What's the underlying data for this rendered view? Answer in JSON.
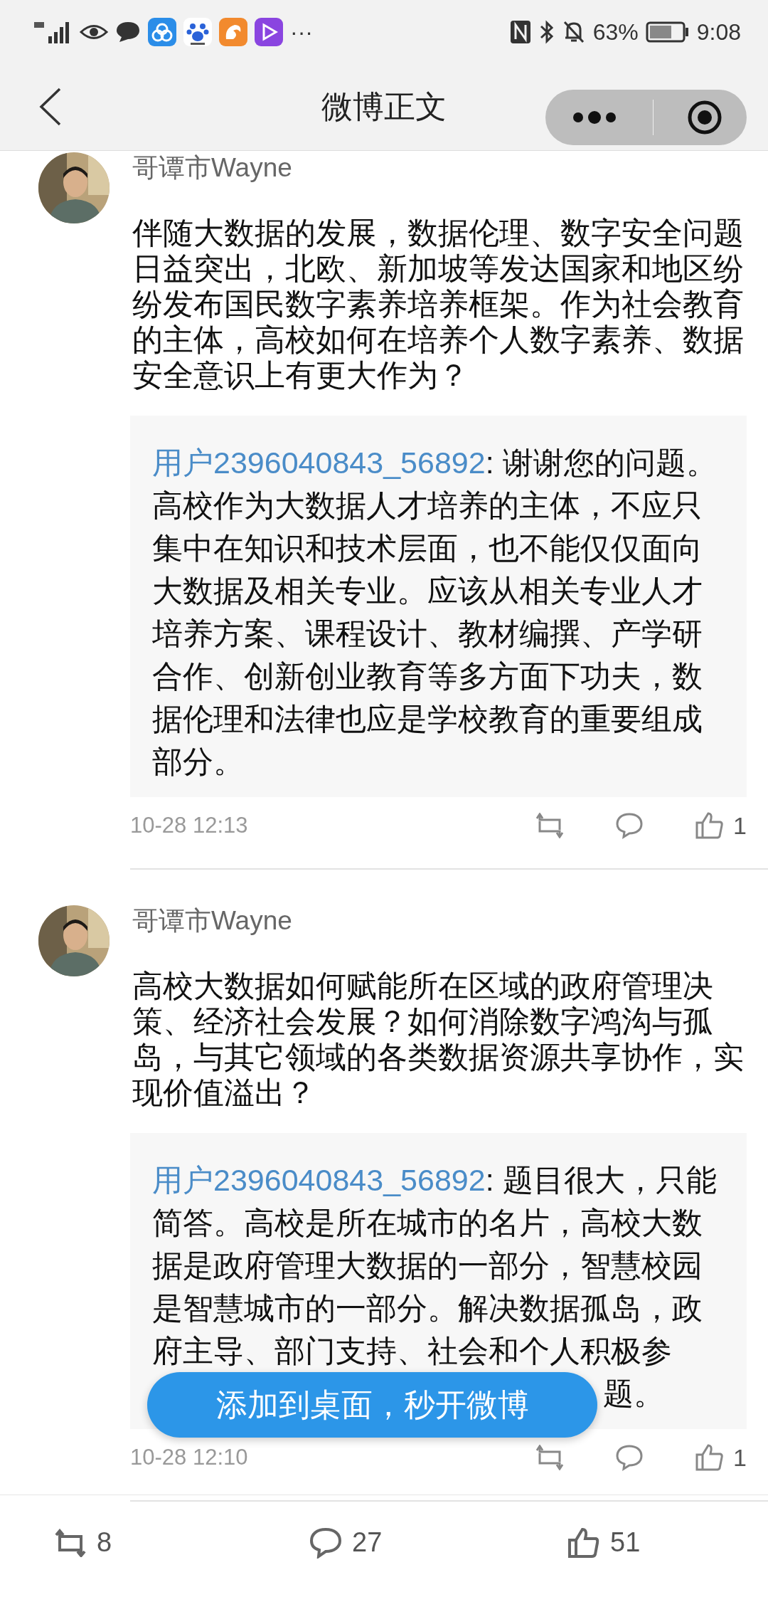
{
  "status_bar": {
    "overflow": "···",
    "battery_percent": "63%",
    "time": "9:08"
  },
  "header": {
    "title": "微博正文"
  },
  "comments": [
    {
      "author": "哥谭市Wayne",
      "text": "伴随大数据的发展，数据伦理、数字安全问题日益突出，北欧、新加坡等发达国家和地区纷纷发布国民数字素养培养框架。作为社会教育的主体，高校如何在培养个人数字素养、数据安全意识上有更大作为？",
      "reply": {
        "user": "用户2396040843_56892",
        "text": ": 谢谢您的问题。高校作为大数据人才培养的主体，不应只集中在知识和技术层面，也不能仅仅面向大数据及相关专业。应该从相关专业人才培养方案、课程设计、教材编撰、产学研合作、创新创业教育等多方面下功夫，数据伦理和法律也应是学校教育的重要组成部分。"
      },
      "time": "10-28 12:13",
      "likes": "1"
    },
    {
      "author": "哥谭市Wayne",
      "text": "高校大数据如何赋能所在区域的政府管理决策、经济社会发展？如何消除数字鸿沟与孤岛，与其它领域的各类数据资源共享协作，实现价值溢出？",
      "reply": {
        "user": "用户2396040843_56892",
        "text": ": 题目很大，只能简答。高校是所在城市的名片，高校大数据是政府管理大数据的一部分，智慧校园是智慧城市的一部分。解决数据孤岛，政府主导、部门支持、社会和个人积极参",
        "tail": "题。"
      },
      "time": "10-28 12:10",
      "likes": "1"
    }
  ],
  "floating_button": {
    "label": "添加到桌面，秒开微博"
  },
  "bottom_bar": {
    "reposts": "8",
    "comments": "27",
    "likes": "51"
  }
}
